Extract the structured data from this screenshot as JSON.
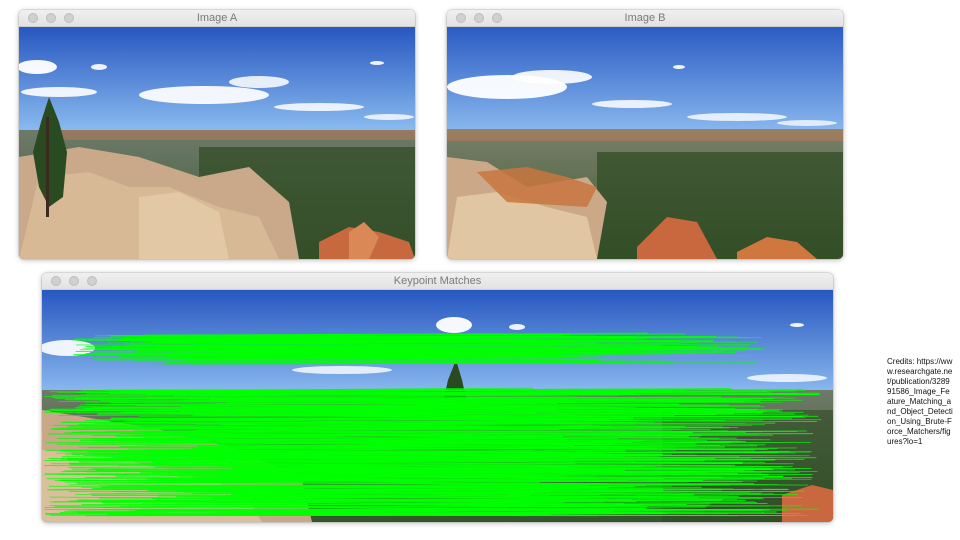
{
  "windows": {
    "image_a": {
      "title": "Image A"
    },
    "image_b": {
      "title": "Image B"
    },
    "matches": {
      "title": "Keypoint Matches"
    }
  },
  "credits": {
    "text": "Credits: https://www.researchgate.net/publication/328991586_Image_Feature_Matching_and_Object_Detection_Using_Brute-Force_Matchers/figures?lo=1"
  },
  "colors": {
    "match_line": "#00ff00",
    "sky_top": "#2f62c8",
    "sky_bottom": "#7fb0ea"
  },
  "icons": {
    "window_controls": [
      "close-dot",
      "minimize-dot",
      "zoom-dot"
    ]
  }
}
